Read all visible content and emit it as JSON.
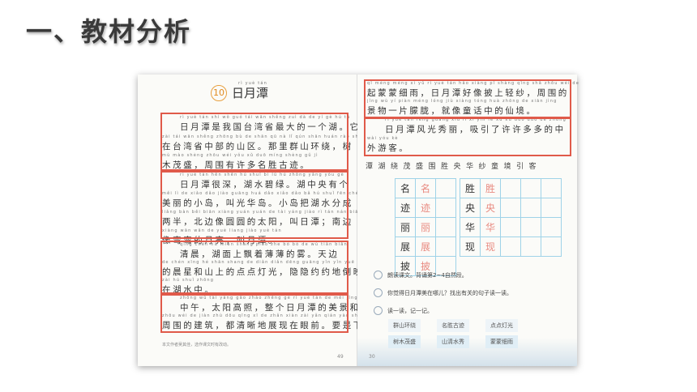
{
  "slide": {
    "title": "一、教材分析"
  },
  "left_page": {
    "lesson_number": "10",
    "lesson_title": "日月潭",
    "lesson_title_pinyin": "rì  yuè  tán",
    "lines": [
      {
        "pinyin": "rì yuè tán shì wǒ guó tái wān shěng zuì dà de yí gè hú tā",
        "text": "日月潭是我国台湾省最大的一个湖。它"
      },
      {
        "pinyin": "zài tái wān shěng zhōng bù de shān qū  nà lǐ qún shān huán rào shù",
        "text": "在台湾省中部的山区。那里群山环绕，树"
      },
      {
        "pinyin": "mù mào shèng  zhōu wéi yǒu xǔ duō míng shèng gǔ jì",
        "text": "木茂盛，周围有许多名胜古迹。"
      },
      {
        "pinyin": "rì yuè tán hěn shēn  hú shuǐ bì lǜ  hú zhōng yāng yǒu gè",
        "text": "日月潭很深，湖水碧绿。湖中央有个"
      },
      {
        "pinyin": "měi lì de xiǎo dǎo  jiào guāng huá dǎo  xiǎo dǎo bǎ hú shuǐ fēn chéng",
        "text": "美丽的小岛，叫光华岛。小岛把湖水分成"
      },
      {
        "pinyin": "liǎng bàn  běi biān xiàng yuán yuán de tài yáng  jiào rì tán  nán biān",
        "text": "两半，北边像圆圆的太阳，叫日潭；南边"
      },
      {
        "pinyin": "xiàng wān wān de yuè liang  jiào yuè tán",
        "text": "像弯弯的月亮，叫月潭。"
      },
      {
        "pinyin": "qīng chén  hú miàn shang piāo zhe bó bó de wù  tiān biān",
        "text": "清晨，湖面上飘着薄薄的雾。天边"
      },
      {
        "pinyin": "de chén xīng hé shān shang de diǎn diǎn dēng guāng  yǐn yǐn yuē yuē de dào yìng",
        "text": "的晨星和山上的点点灯光，隐隐约约地倒映"
      },
      {
        "pinyin": "zài hú shuǐ zhōng",
        "text": "在湖水中。"
      },
      {
        "pinyin": "zhōng wǔ  tài yáng gāo zhào  zhěng gè rì yuè tán de měi jǐng hé",
        "text": "中午，太阳高照，整个日月潭的美景和"
      },
      {
        "pinyin": "zhōu wéi de jiàn zhù  dōu qīng xī de zhǎn xiàn zài yǎn qián  yào shi xià",
        "text": "周围的建筑，都清晰地展现在眼前。要是下"
      }
    ],
    "footnote": "本文作者吴其佳，选作课文时有改动。",
    "page_number": "49"
  },
  "right_page": {
    "lines": [
      {
        "pinyin": "qǐ méng méng xì yǔ  rì yuè tán hǎo xiàng pī shàng qīng shā  zhōu wéi de",
        "text": "起蒙蒙细雨，日月潭好像披上轻纱，周围的"
      },
      {
        "pinyin": "jǐng wù yí piàn méng lóng  jiù xiàng tóng huà zhōng de xiān jìng",
        "text": "景物一片朦胧，就像童话中的仙境。"
      },
      {
        "pinyin": "rì yuè tán fēng guāng xiù lì  xī yǐn le xǔ xǔ duō duō de zhōng",
        "text": "日月潭风光秀丽，吸引了许许多多的中"
      },
      {
        "pinyin": "wài yóu kè",
        "text": "外游客。"
      }
    ],
    "char_row": "潭湖绕茂盛围胜央华纱童境引客",
    "grid_rows": [
      [
        "名",
        "名",
        "胜",
        "胜"
      ],
      [
        "迹",
        "迹",
        "央",
        "央"
      ],
      [
        "丽",
        "丽",
        "华",
        "华"
      ],
      [
        "展",
        "展",
        "现",
        "现"
      ],
      [
        "披",
        "披",
        "",
        ""
      ]
    ],
    "questions": [
      "朗读课文。背诵第2~4自然段。",
      "你觉得日月潭美在哪儿？找出有关的句子读一读。",
      "读一读，记一记。"
    ],
    "word_cards": [
      "群山环绕",
      "名胜古迹",
      "点点灯光",
      "树木茂盛",
      "山清水秀",
      "蒙蒙细雨"
    ],
    "page_number": "30"
  },
  "colors": {
    "highlight_box": "#e05a4a",
    "grid_line": "#9fd3e8",
    "trace_char": "#e88a80",
    "lesson_badge": "#e08a20"
  }
}
